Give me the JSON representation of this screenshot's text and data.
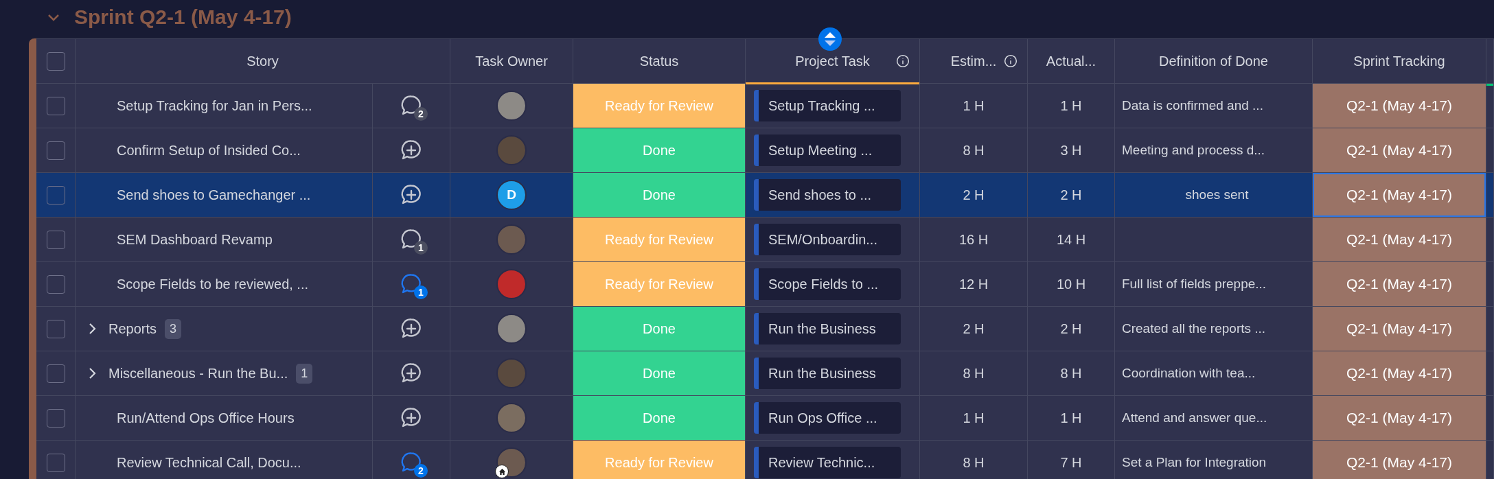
{
  "group": {
    "title": "Sprint Q2-1 (May 4-17)",
    "expanded": true,
    "color": "#8a5a48"
  },
  "select_all": {
    "checked": false
  },
  "columns": [
    {
      "label": "Story",
      "info": false,
      "selected": false
    },
    {
      "label": "Task Owner",
      "info": false,
      "selected": false
    },
    {
      "label": "Status",
      "info": false,
      "selected": false
    },
    {
      "label": "Project Task",
      "info": true,
      "selected": true
    },
    {
      "label": "Estim...",
      "info": true,
      "selected": false
    },
    {
      "label": "Actual...",
      "info": false,
      "selected": false
    },
    {
      "label": "Definition of Done",
      "info": false,
      "selected": false
    },
    {
      "label": "Sprint Tracking",
      "info": false,
      "selected": false
    }
  ],
  "rows": [
    {
      "selected": false,
      "checked": false,
      "story": "Setup Tracking for Jan in Pers...",
      "has_subitems": false,
      "comments": {
        "kind": "count",
        "count": "2",
        "unread": false
      },
      "owner": {
        "kind": "photo"
      },
      "status": {
        "label": "Ready for Review",
        "color": "#fdbc64"
      },
      "project_task": "Setup Tracking ...",
      "estimate": "1 H",
      "actual": "1 H",
      "done": "Data is confirmed and ...",
      "sprint": {
        "label": "Q2-1 (May 4-17)",
        "selected": false
      }
    },
    {
      "selected": false,
      "checked": false,
      "story": "Confirm Setup of Insided Co...",
      "has_subitems": false,
      "comments": {
        "kind": "add"
      },
      "owner": {
        "kind": "photo"
      },
      "status": {
        "label": "Done",
        "color": "#33d391"
      },
      "project_task": "Setup Meeting ...",
      "estimate": "8 H",
      "actual": "3 H",
      "done": "Meeting and process d...",
      "sprint": {
        "label": "Q2-1 (May 4-17)",
        "selected": false
      }
    },
    {
      "selected": true,
      "checked": false,
      "story": "Send shoes to Gamechanger ...",
      "has_subitems": false,
      "comments": {
        "kind": "add"
      },
      "owner": {
        "kind": "initial",
        "initial": "D"
      },
      "status": {
        "label": "Done",
        "color": "#33d391"
      },
      "project_task": "Send shoes to ...",
      "estimate": "2 H",
      "actual": "2 H",
      "done": "shoes sent",
      "sprint": {
        "label": "Q2-1 (May 4-17)",
        "selected": true
      }
    },
    {
      "selected": false,
      "checked": false,
      "story": "SEM Dashboard Revamp",
      "has_subitems": false,
      "comments": {
        "kind": "count",
        "count": "1",
        "unread": false
      },
      "owner": {
        "kind": "photo"
      },
      "status": {
        "label": "Ready for Review",
        "color": "#fdbc64"
      },
      "project_task": "SEM/Onboardin...",
      "estimate": "16 H",
      "actual": "14 H",
      "sprint": {
        "label": "Q2-1 (May 4-17)",
        "selected": false
      }
    },
    {
      "selected": false,
      "checked": false,
      "story": "Scope Fields to be reviewed, ...",
      "has_subitems": false,
      "comments": {
        "kind": "count",
        "count": "1",
        "unread": true
      },
      "owner": {
        "kind": "photo"
      },
      "status": {
        "label": "Ready for Review",
        "color": "#fdbc64"
      },
      "project_task": "Scope Fields to ...",
      "estimate": "12 H",
      "actual": "10 H",
      "done": "Full list of fields preppe...",
      "sprint": {
        "label": "Q2-1 (May 4-17)",
        "selected": false
      }
    },
    {
      "selected": false,
      "checked": false,
      "story": "Reports",
      "has_subitems": true,
      "subitem_count": "3",
      "comments": {
        "kind": "add"
      },
      "owner": {
        "kind": "photo"
      },
      "status": {
        "label": "Done",
        "color": "#33d391"
      },
      "project_task": "Run the Business",
      "estimate": "2 H",
      "actual": "2 H",
      "done": "Created all the reports ...",
      "sprint": {
        "label": "Q2-1 (May 4-17)",
        "selected": false
      }
    },
    {
      "selected": false,
      "checked": false,
      "story": "Miscellaneous - Run the Bu...",
      "has_subitems": true,
      "subitem_count": "1",
      "comments": {
        "kind": "add"
      },
      "owner": {
        "kind": "photo"
      },
      "status": {
        "label": "Done",
        "color": "#33d391"
      },
      "project_task": "Run the Business",
      "estimate": "8 H",
      "actual": "8 H",
      "done": "Coordination with tea...",
      "sprint": {
        "label": "Q2-1 (May 4-17)",
        "selected": false
      }
    },
    {
      "selected": false,
      "checked": false,
      "story": "Run/Attend Ops Office Hours",
      "has_subitems": false,
      "comments": {
        "kind": "add"
      },
      "owner": {
        "kind": "photo"
      },
      "status": {
        "label": "Done",
        "color": "#33d391"
      },
      "project_task": "Run Ops Office ...",
      "estimate": "1 H",
      "actual": "1 H",
      "done": "Attend and answer que...",
      "sprint": {
        "label": "Q2-1 (May 4-17)",
        "selected": false
      }
    },
    {
      "selected": false,
      "checked": false,
      "story": "Review Technical Call, Docu...",
      "has_subitems": false,
      "comments": {
        "kind": "count",
        "count": "2",
        "unread": true
      },
      "owner": {
        "kind": "photo",
        "home_badge": true
      },
      "status": {
        "label": "Ready for Review",
        "color": "#fdbc64"
      },
      "project_task": "Review Technic...",
      "estimate": "8 H",
      "actual": "7 H",
      "done": "Set a Plan for Integration",
      "sprint": {
        "label": "Q2-1 (May 4-17)",
        "selected": false
      }
    }
  ]
}
